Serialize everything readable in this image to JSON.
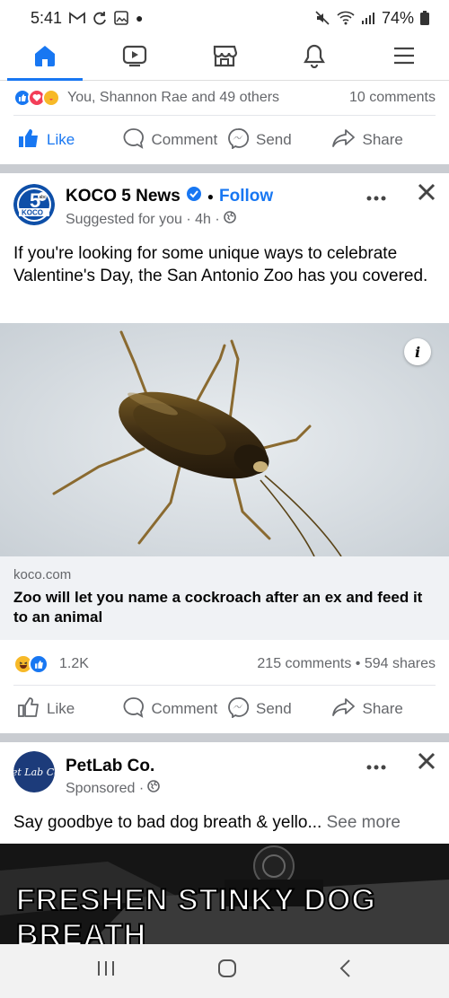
{
  "status_bar": {
    "time": "5:41",
    "battery": "74%"
  },
  "top_nav": {
    "tabs": [
      {
        "name": "home",
        "icon": "home-icon",
        "active": true
      },
      {
        "name": "video",
        "icon": "video-icon",
        "active": false
      },
      {
        "name": "marketplace",
        "icon": "store-icon",
        "active": false
      },
      {
        "name": "notifications",
        "icon": "bell-icon",
        "active": false
      },
      {
        "name": "menu",
        "icon": "hamburger-icon",
        "active": false
      }
    ],
    "accent_color": "#1877f2"
  },
  "previous_post": {
    "reactions_text": "You, Shannon Rae and 49 others",
    "comments_text": "10 comments",
    "actions": {
      "like": "Like",
      "comment": "Comment",
      "send": "Send",
      "share": "Share"
    }
  },
  "koco_post": {
    "author": "KOCO 5 News",
    "follow_label": "Follow",
    "subtitle": "Suggested for you · 4h ·",
    "text": "If you're looking for some unique ways to celebrate Valentine's Day, the San Antonio Zoo has you covered.",
    "info_badge": "i",
    "link_domain": "koco.com",
    "link_title": "Zoo will let you name a cockroach after an ex and feed it to an animal",
    "reaction_count": "1.2K",
    "stats_text": "215 comments • 594 shares",
    "actions": {
      "like": "Like",
      "comment": "Comment",
      "send": "Send",
      "share": "Share"
    },
    "logo_text_top": "5",
    "logo_text_bottom": "KOCO",
    "logo_abc": "abc"
  },
  "petlab_post": {
    "author": "PetLab Co.",
    "subtitle": "Sponsored ·",
    "text": "Say goodbye to bad dog breath & yello...",
    "see_more": "See more",
    "logo_text": "Pet Lab Co.",
    "promo_caption": "FRESHEN STINKY DOG BREATH"
  }
}
